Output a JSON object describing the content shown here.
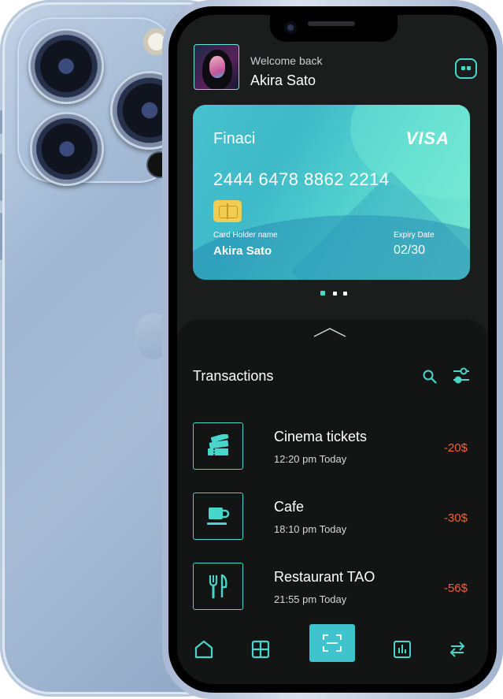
{
  "header": {
    "greeting": "Welcome back",
    "user_name": "Akira Sato",
    "avatar_icon": "user-avatar-photo",
    "chat_icon": "chat-bubble-icon"
  },
  "card": {
    "brand": "Finaci",
    "network": "VISA",
    "number": "2444 6478 8862 2214",
    "holder_label": "Card Holder name",
    "holder_name": "Akira Sato",
    "expiry_label": "Expiry Date",
    "expiry_value": "02/30",
    "pager": {
      "count": 3,
      "active_index": 0
    }
  },
  "transactions": {
    "title": "Transactions",
    "items": [
      {
        "name": "Cinema tickets",
        "time": "12:20 pm Today",
        "amount": "-20$",
        "icon": "tickets-icon"
      },
      {
        "name": "Cafe",
        "time": "18:10 pm Today",
        "amount": "-30$",
        "icon": "coffee-cup-icon"
      },
      {
        "name": "Restaurant TAO",
        "time": "21:55 pm Today",
        "amount": "-56$",
        "icon": "fork-knife-icon"
      }
    ]
  },
  "nav": {
    "items": [
      "home-icon",
      "grid-icon",
      "scan-icon",
      "stats-icon",
      "transfer-icon"
    ],
    "active": "scan-icon"
  },
  "colors": {
    "accent": "#47d6c9",
    "negative_amount": "#f4623a",
    "screen_bg": "#1b1d1d",
    "sheet_bg": "#131414",
    "phone_back": "#a8bcd6"
  }
}
